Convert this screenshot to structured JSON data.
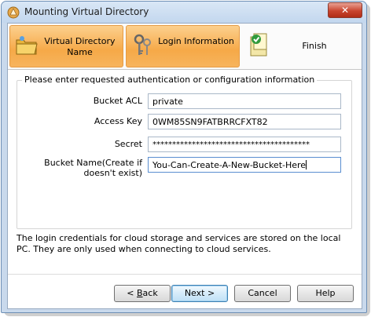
{
  "window": {
    "title": "Mounting Virtual Directory",
    "close_label": "✕"
  },
  "steps": [
    {
      "label": "Virtual Directory Name",
      "state": "done",
      "icon": "folder-icon"
    },
    {
      "label": "Login Information",
      "state": "done",
      "icon": "keys-icon"
    },
    {
      "label": "Finish",
      "state": "current",
      "icon": "check-document-icon"
    }
  ],
  "form": {
    "group_title": "Please enter requested authentication or configuration information",
    "fields": [
      {
        "label": "Bucket ACL",
        "value": "private"
      },
      {
        "label": "Access Key",
        "value": "0WM85SN9FATBRRCFXT82"
      },
      {
        "label": "Secret",
        "value": "****************************************"
      },
      {
        "label": "Bucket Name(Create if doesn't exist)",
        "value": "You-Can-Create-A-New-Bucket-Here"
      }
    ]
  },
  "info_text": "The login credentials for cloud storage and services are stored on the local PC. They are only used when connecting to cloud services.",
  "buttons": {
    "back": {
      "prefix": "< ",
      "accel": "B",
      "rest": "ack"
    },
    "next": {
      "label": "Next >"
    },
    "cancel": {
      "label": "Cancel"
    },
    "help": {
      "label": "Help"
    }
  },
  "colors": {
    "step_done": "#f6a948",
    "close_button": "#c9452f",
    "title_bar": "#c3d7ee"
  }
}
